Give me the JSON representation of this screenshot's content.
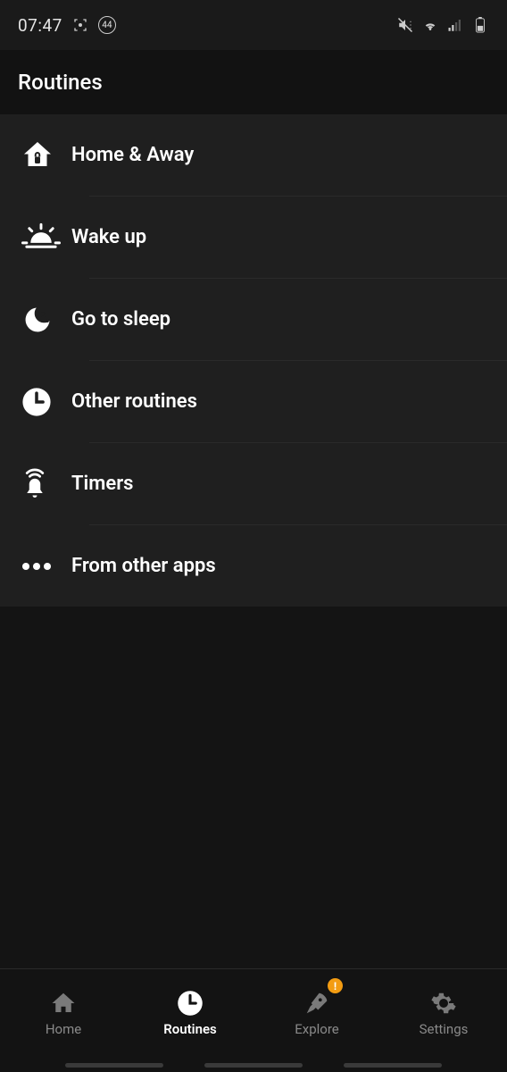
{
  "status": {
    "time": "07:47",
    "badge_count": "44"
  },
  "header": {
    "title": "Routines"
  },
  "routines": [
    {
      "id": "home-away",
      "label": "Home & Away",
      "icon": "home-lock"
    },
    {
      "id": "wake-up",
      "label": "Wake up",
      "icon": "sunrise"
    },
    {
      "id": "go-to-sleep",
      "label": "Go to sleep",
      "icon": "moon-zz"
    },
    {
      "id": "other-routines",
      "label": "Other routines",
      "icon": "clock"
    },
    {
      "id": "timers",
      "label": "Timers",
      "icon": "bell-waves"
    },
    {
      "id": "from-other-apps",
      "label": "From other apps",
      "icon": "dots"
    }
  ],
  "nav": {
    "items": [
      {
        "id": "home",
        "label": "Home",
        "active": false,
        "badge": false
      },
      {
        "id": "routines",
        "label": "Routines",
        "active": true,
        "badge": false
      },
      {
        "id": "explore",
        "label": "Explore",
        "active": false,
        "badge": true
      },
      {
        "id": "settings",
        "label": "Settings",
        "active": false,
        "badge": false
      }
    ],
    "badge_glyph": "!"
  }
}
